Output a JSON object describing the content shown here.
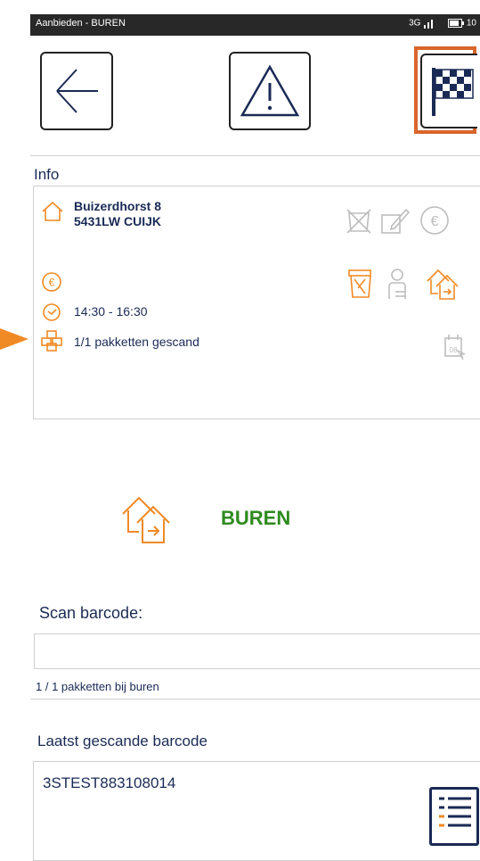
{
  "status_bar": {
    "title": "Aanbieden - BUREN",
    "network": "3G",
    "battery": "10"
  },
  "toolbar": {
    "back_icon": "arrow-left-icon",
    "warning_icon": "warning-triangle-icon",
    "finish_icon": "checkered-flag-icon"
  },
  "info": {
    "heading": "Info",
    "address_line1": "Buizerdhorst 8",
    "address_line2": "5431LW CUIJK",
    "time": "14:30 - 16:30",
    "packages": "1/1 pakketten gescand"
  },
  "result": {
    "label": "BUREN",
    "accent": "#f08a24",
    "label_color": "#2e8b1e"
  },
  "scan": {
    "label": "Scan barcode:",
    "value": "",
    "counter": "1 / 1 pakketten bij buren"
  },
  "last_scanned": {
    "label": "Laatst gescande barcode",
    "barcode": "3STEST883108014"
  }
}
